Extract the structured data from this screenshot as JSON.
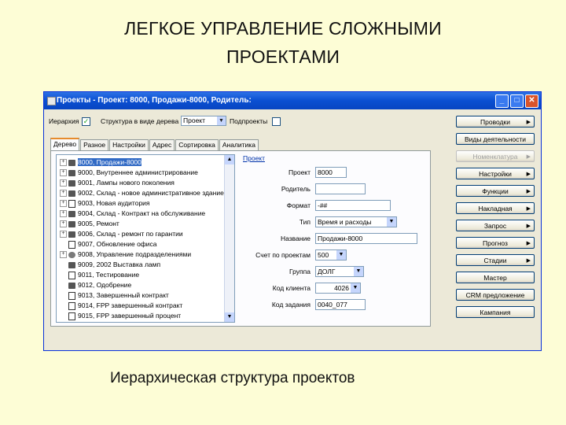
{
  "slide": {
    "title_line1": "ЛЕГКОЕ УПРАВЛЕНИЕ СЛОЖНЫМИ",
    "title_line2": "ПРОЕКТАМИ",
    "caption": "Иерархическая структура проектов"
  },
  "window": {
    "title": "Проекты - Проект: 8000, Продажи-8000, Родитель:",
    "buttons": {
      "minimize": "_",
      "maximize": "□",
      "close": "✕"
    }
  },
  "toolbar": {
    "hierarchy_label": "Иерархия",
    "hierarchy_checked": true,
    "tree_structure_label": "Структура в виде дерева",
    "tree_structure_value": "Проект",
    "subprojects_label": "Подпроекты",
    "subprojects_checked": false
  },
  "tabs": [
    "Дерево",
    "Разное",
    "Настройки",
    "Адрес",
    "Сортировка",
    "Аналитика"
  ],
  "tree": [
    {
      "code": "8000, Продажи-8000",
      "icon": "project-icon",
      "expand": "+",
      "selected": true
    },
    {
      "code": "9000, Внутреннее администрирование",
      "icon": "project-icon",
      "expand": "+"
    },
    {
      "code": "9001, Лампы нового поколения",
      "icon": "project-icon",
      "expand": "+"
    },
    {
      "code": "9002, Склад - новое административное здание",
      "icon": "project-icon",
      "expand": "+"
    },
    {
      "code": "9003, Новая аудитория",
      "icon": "document-icon",
      "expand": "+"
    },
    {
      "code": "9004, Склад - Контракт на обслуживание",
      "icon": "project-icon",
      "expand": "+"
    },
    {
      "code": "9005, Ремонт",
      "icon": "project-icon",
      "expand": "+"
    },
    {
      "code": "9006, Склад - ремонт по гарантии",
      "icon": "project-icon",
      "expand": "+"
    },
    {
      "code": "9007, Обновление офиса",
      "icon": "document-icon",
      "expand": ""
    },
    {
      "code": "9008, Управление подразделениями",
      "icon": "tool-icon",
      "expand": "+"
    },
    {
      "code": "9009, 2002 Выставка ламп",
      "icon": "project-icon",
      "expand": ""
    },
    {
      "code": "9011, Тестирование",
      "icon": "document-icon",
      "expand": ""
    },
    {
      "code": "9012, Одобрение",
      "icon": "project-icon",
      "expand": ""
    },
    {
      "code": "9013, Завершенный контракт",
      "icon": "document-icon",
      "expand": ""
    },
    {
      "code": "9014, FPP завершенный контракт",
      "icon": "document-icon",
      "expand": ""
    },
    {
      "code": "9015, FPP завершенный процент",
      "icon": "document-icon",
      "expand": ""
    }
  ],
  "details": {
    "section_link": "Проект",
    "fields": [
      {
        "label": "Проект",
        "value": "8000"
      },
      {
        "label": "Родитель",
        "value": ""
      },
      {
        "label": "Формат",
        "value": "-##"
      },
      {
        "label": "Тип",
        "value": "Время и расходы"
      },
      {
        "label": "Название",
        "value": "Продажи-8000"
      },
      {
        "label": "Счет по проектам",
        "value": "500"
      },
      {
        "label": "Группа",
        "value": "ДОЛГ"
      },
      {
        "label": "Код клиента",
        "value": "4026"
      },
      {
        "label": "Код задания",
        "value": "0040_077"
      }
    ]
  },
  "side_buttons": [
    {
      "label": "Проводки",
      "arrow": "▶",
      "enabled": true
    },
    {
      "label": "Виды деятельности",
      "arrow": "",
      "enabled": true
    },
    {
      "label": "Номенклатура",
      "arrow": "▶",
      "enabled": false
    },
    {
      "label": "Настройки",
      "arrow": "▶",
      "enabled": true
    },
    {
      "label": "Функции",
      "arrow": "▶",
      "enabled": true
    },
    {
      "label": "Накладная",
      "arrow": "▶",
      "enabled": true
    },
    {
      "label": "Запрос",
      "arrow": "▶",
      "enabled": true
    },
    {
      "label": "Прогноз",
      "arrow": "▶",
      "enabled": true
    },
    {
      "label": "Стадии",
      "arrow": "▶",
      "enabled": true
    },
    {
      "label": "Мастер",
      "arrow": "",
      "enabled": true
    },
    {
      "label": "CRM предложение",
      "arrow": "",
      "enabled": true
    },
    {
      "label": "Кампания",
      "arrow": "",
      "enabled": true
    }
  ],
  "colors": {
    "slide_background": "#fdfdd6",
    "titlebar": "#0a4fd1",
    "selection": "#316ac5"
  }
}
